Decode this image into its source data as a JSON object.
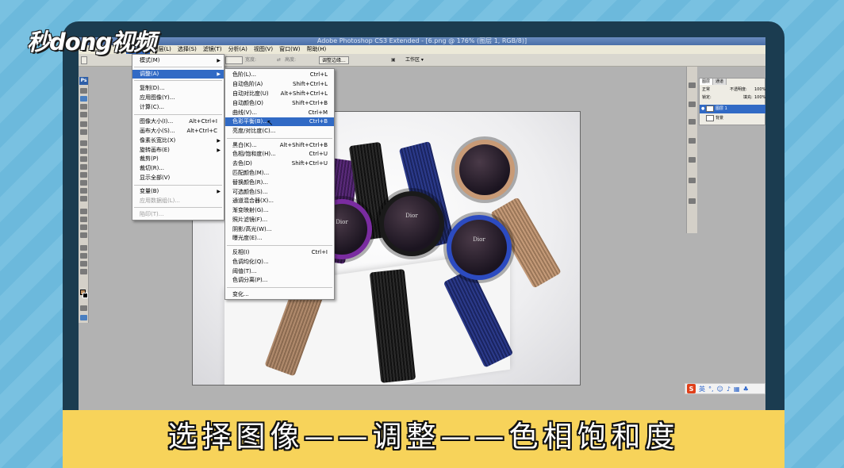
{
  "brand": {
    "logo_text": "秒dong视频"
  },
  "window": {
    "title": "Adobe Photoshop CS3 Extended - [6.png @ 176% (图层 1, RGB/8)]"
  },
  "menubar": {
    "items": [
      {
        "label": "图像(I)",
        "active": true
      },
      {
        "label": "图层(L)"
      },
      {
        "label": "选择(S)"
      },
      {
        "label": "滤镜(T)"
      },
      {
        "label": "分析(A)"
      },
      {
        "label": "视图(V)"
      },
      {
        "label": "窗口(W)"
      },
      {
        "label": "帮助(H)"
      }
    ]
  },
  "options_bar": {
    "width_label": "宽度:",
    "height_label": "高度:",
    "refine_edge": "调整边缘...",
    "workspace": "工作区 ▾"
  },
  "image_menu": {
    "items": [
      {
        "label": "模式(M)",
        "has_sub": true
      },
      {
        "label": "调整(A)",
        "has_sub": true,
        "highlight": true
      },
      {
        "label": "复制(D)..."
      },
      {
        "label": "应用图像(Y)..."
      },
      {
        "label": "计算(C)..."
      },
      {
        "label": "图像大小(I)...",
        "shortcut": "Alt+Ctrl+I"
      },
      {
        "label": "画布大小(S)...",
        "shortcut": "Alt+Ctrl+C"
      },
      {
        "label": "像素长宽比(X)",
        "has_sub": true
      },
      {
        "label": "旋转画布(E)",
        "has_sub": true
      },
      {
        "label": "裁剪(P)"
      },
      {
        "label": "裁切(R)..."
      },
      {
        "label": "显示全部(V)"
      },
      {
        "label": "变量(B)",
        "has_sub": true
      },
      {
        "label": "应用数据组(L)...",
        "disabled": true
      },
      {
        "label": "陷印(T)...",
        "disabled": true
      }
    ]
  },
  "adjust_menu": {
    "items": [
      {
        "label": "色阶(L)...",
        "shortcut": "Ctrl+L"
      },
      {
        "label": "自动色阶(A)",
        "shortcut": "Shift+Ctrl+L"
      },
      {
        "label": "自动对比度(U)",
        "shortcut": "Alt+Shift+Ctrl+L"
      },
      {
        "label": "自动颜色(O)",
        "shortcut": "Shift+Ctrl+B"
      },
      {
        "label": "曲线(V)...",
        "shortcut": "Ctrl+M"
      },
      {
        "label": "色彩平衡(B)...",
        "shortcut": "Ctrl+B",
        "highlight": true
      },
      {
        "label": "亮度/对比度(C)..."
      },
      {
        "label": "黑白(K)...",
        "shortcut": "Alt+Shift+Ctrl+B"
      },
      {
        "label": "色相/饱和度(H)...",
        "shortcut": "Ctrl+U"
      },
      {
        "label": "去色(D)",
        "shortcut": "Shift+Ctrl+U"
      },
      {
        "label": "匹配颜色(M)..."
      },
      {
        "label": "替换颜色(R)..."
      },
      {
        "label": "可选颜色(S)..."
      },
      {
        "label": "通道混合器(X)..."
      },
      {
        "label": "渐变映射(G)..."
      },
      {
        "label": "照片滤镜(F)..."
      },
      {
        "label": "阴影/高光(W)..."
      },
      {
        "label": "曝光度(E)..."
      },
      {
        "label": "反相(I)",
        "shortcut": "Ctrl+I"
      },
      {
        "label": "色调均化(Q)..."
      },
      {
        "label": "阈值(T)..."
      },
      {
        "label": "色调分离(P)..."
      },
      {
        "label": "变化..."
      }
    ]
  },
  "layers_panel": {
    "tabs": [
      "图层",
      "通道"
    ],
    "blend_mode": "正常",
    "opacity_label": "不透明度:",
    "opacity_value": "100%",
    "lock_label": "锁定:",
    "fill_label": "填充:",
    "fill_value": "100%",
    "layers": [
      {
        "name": "图层 1",
        "selected": true
      },
      {
        "name": "背景"
      }
    ]
  },
  "image_content": {
    "dial_brand": "Dior"
  },
  "ime_tray": {
    "lang": "英"
  },
  "caption": {
    "text": "选择图像——调整——色相饱和度"
  },
  "colors": {
    "highlight": "#316ac5",
    "caption_band": "#f7d35a",
    "frame": "#1b3c50"
  }
}
